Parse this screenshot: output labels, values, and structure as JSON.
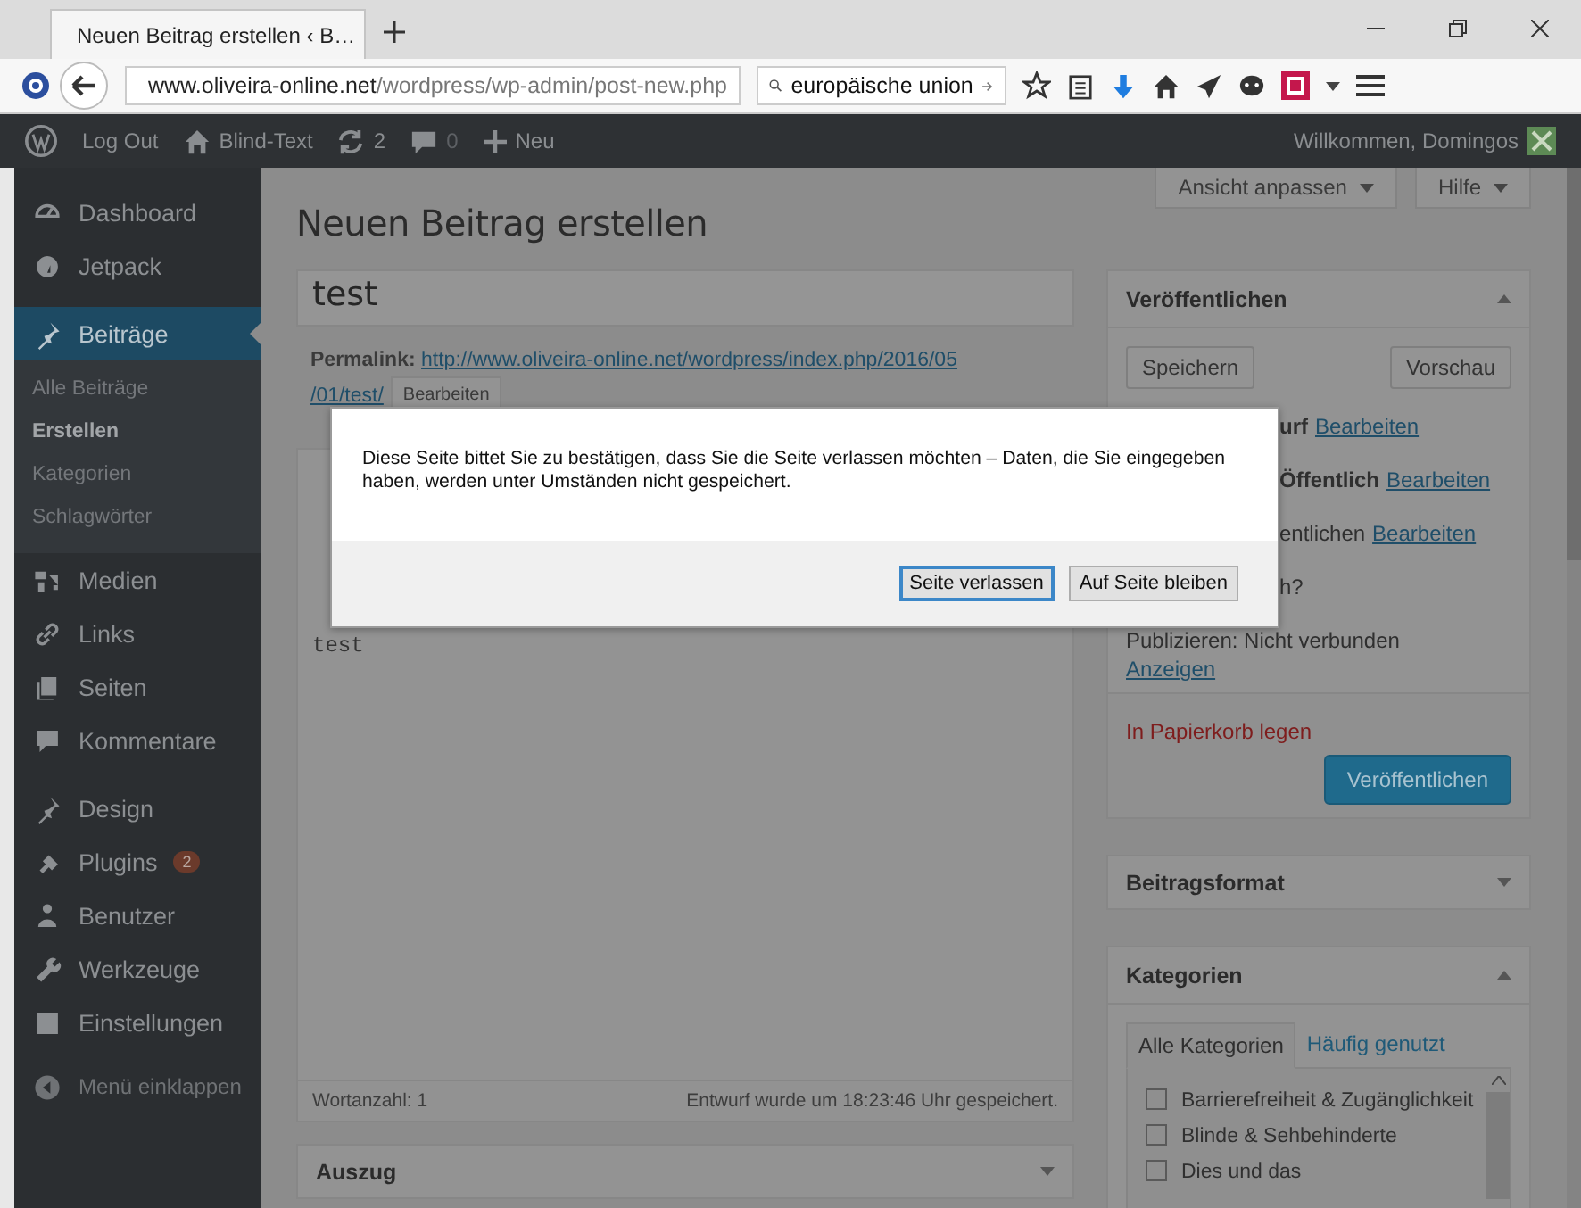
{
  "browser": {
    "tab_title": "Neuen Beitrag erstellen ‹ B…",
    "url_host": "www.oliveira-online.net",
    "url_path": "/wordpress/wp-admin/post-new.php",
    "search_value": "europäische union"
  },
  "admin_bar": {
    "logout": "Log Out",
    "site": "Blind-Text",
    "updates": "2",
    "comments": "0",
    "new": "Neu",
    "greeting": "Willkommen, Domingos"
  },
  "screen_options": {
    "customize": "Ansicht anpassen",
    "help": "Hilfe"
  },
  "sidebar": {
    "items": [
      {
        "label": "Dashboard",
        "selected": false
      },
      {
        "label": "Jetpack",
        "selected": false
      },
      {
        "label": "Beiträge",
        "selected": true,
        "children": [
          {
            "label": "Alle Beiträge",
            "selected": false
          },
          {
            "label": "Erstellen",
            "selected": true
          },
          {
            "label": "Kategorien",
            "selected": false
          },
          {
            "label": "Schlagwörter",
            "selected": false
          }
        ]
      },
      {
        "label": "Medien",
        "selected": false
      },
      {
        "label": "Links",
        "selected": false
      },
      {
        "label": "Seiten",
        "selected": false
      },
      {
        "label": "Kommentare",
        "selected": false
      },
      {
        "label": "Design",
        "selected": false
      },
      {
        "label": "Plugins",
        "selected": false,
        "badge": "2"
      },
      {
        "label": "Benutzer",
        "selected": false
      },
      {
        "label": "Werkzeuge",
        "selected": false
      },
      {
        "label": "Einstellungen",
        "selected": false
      }
    ],
    "collapse": "Menü einklappen"
  },
  "editor": {
    "heading": "Neuen Beitrag erstellen",
    "title_value": "test",
    "permalink_label": "Permalink:",
    "permalink_lines": [
      "http://www.oliveira-online.net/wordpress/index.php/2016/05",
      "/01/test/"
    ],
    "edit_button": "Bearbeiten",
    "content": "test",
    "word_count": "Wortanzahl: 1",
    "saved": "Entwurf wurde um 18:23:46 Uhr gespeichert.",
    "excerpt": {
      "title": "Auszug",
      "expanded": false
    }
  },
  "publish_box": {
    "title": "Veröffentlichen",
    "expanded": true,
    "save": "Speichern",
    "preview": "Vorschau",
    "status_rows": [
      {
        "text": "**urf**",
        "link": "Bearbeiten"
      },
      {
        "text": "**Öffentlich**",
        "link": "Bearbeiten"
      },
      {
        "text": "entlichen",
        "link": "Bearbeiten"
      },
      {
        "text": "h?"
      }
    ],
    "publicize": "Publizieren: Nicht verbunden",
    "show_link": "Anzeigen",
    "trash": "In Papierkorb legen",
    "publish": "Veröffentlichen"
  },
  "format_box": {
    "title": "Beitragsformat",
    "expanded": false
  },
  "categories_box": {
    "title": "Kategorien",
    "expanded": true,
    "tabs": [
      {
        "label": "Alle Kategorien",
        "selected": true
      },
      {
        "label": "Häufig genutzt",
        "selected": false
      }
    ],
    "items": [
      {
        "label": "Barrierefreiheit & Zugänglichkeit",
        "checked": false
      },
      {
        "label": "Blinde & Sehbehinderte",
        "checked": false
      },
      {
        "label": "Dies und das",
        "checked": false
      }
    ]
  },
  "dialog": {
    "message": "Diese Seite bittet Sie zu bestätigen, dass Sie die Seite verlassen möchten – Daten, die Sie eingegeben haben, werden unter Umständen nicht gespeichert.",
    "buttons": [
      {
        "label": "Seite verlassen",
        "selected": true
      },
      {
        "label": "Auf Seite bleiben",
        "selected": false
      }
    ]
  }
}
